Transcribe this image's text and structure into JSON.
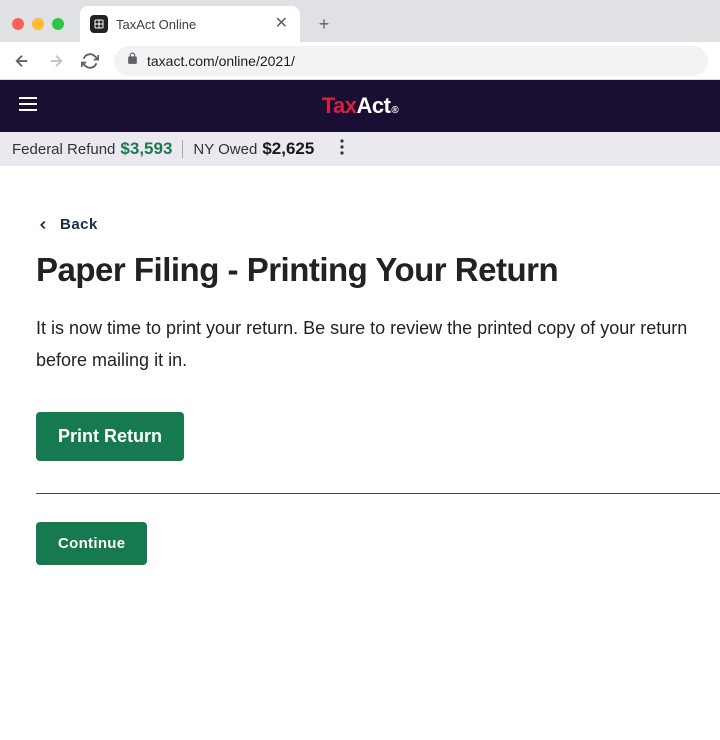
{
  "browser": {
    "tab_title": "TaxAct Online",
    "url": "taxact.com/online/2021/"
  },
  "header": {
    "logo_tax": "Tax",
    "logo_act": "Act"
  },
  "status": {
    "federal_label": "Federal Refund",
    "federal_amount": "$3,593",
    "state_label": "NY Owed",
    "state_amount": "$2,625"
  },
  "content": {
    "back_label": "Back",
    "title": "Paper Filing - Printing Your Return",
    "body": "It is now time to print your return. Be sure to review the printed copy of your return before mailing it in.",
    "print_button": "Print Return",
    "continue_button": "Continue"
  }
}
